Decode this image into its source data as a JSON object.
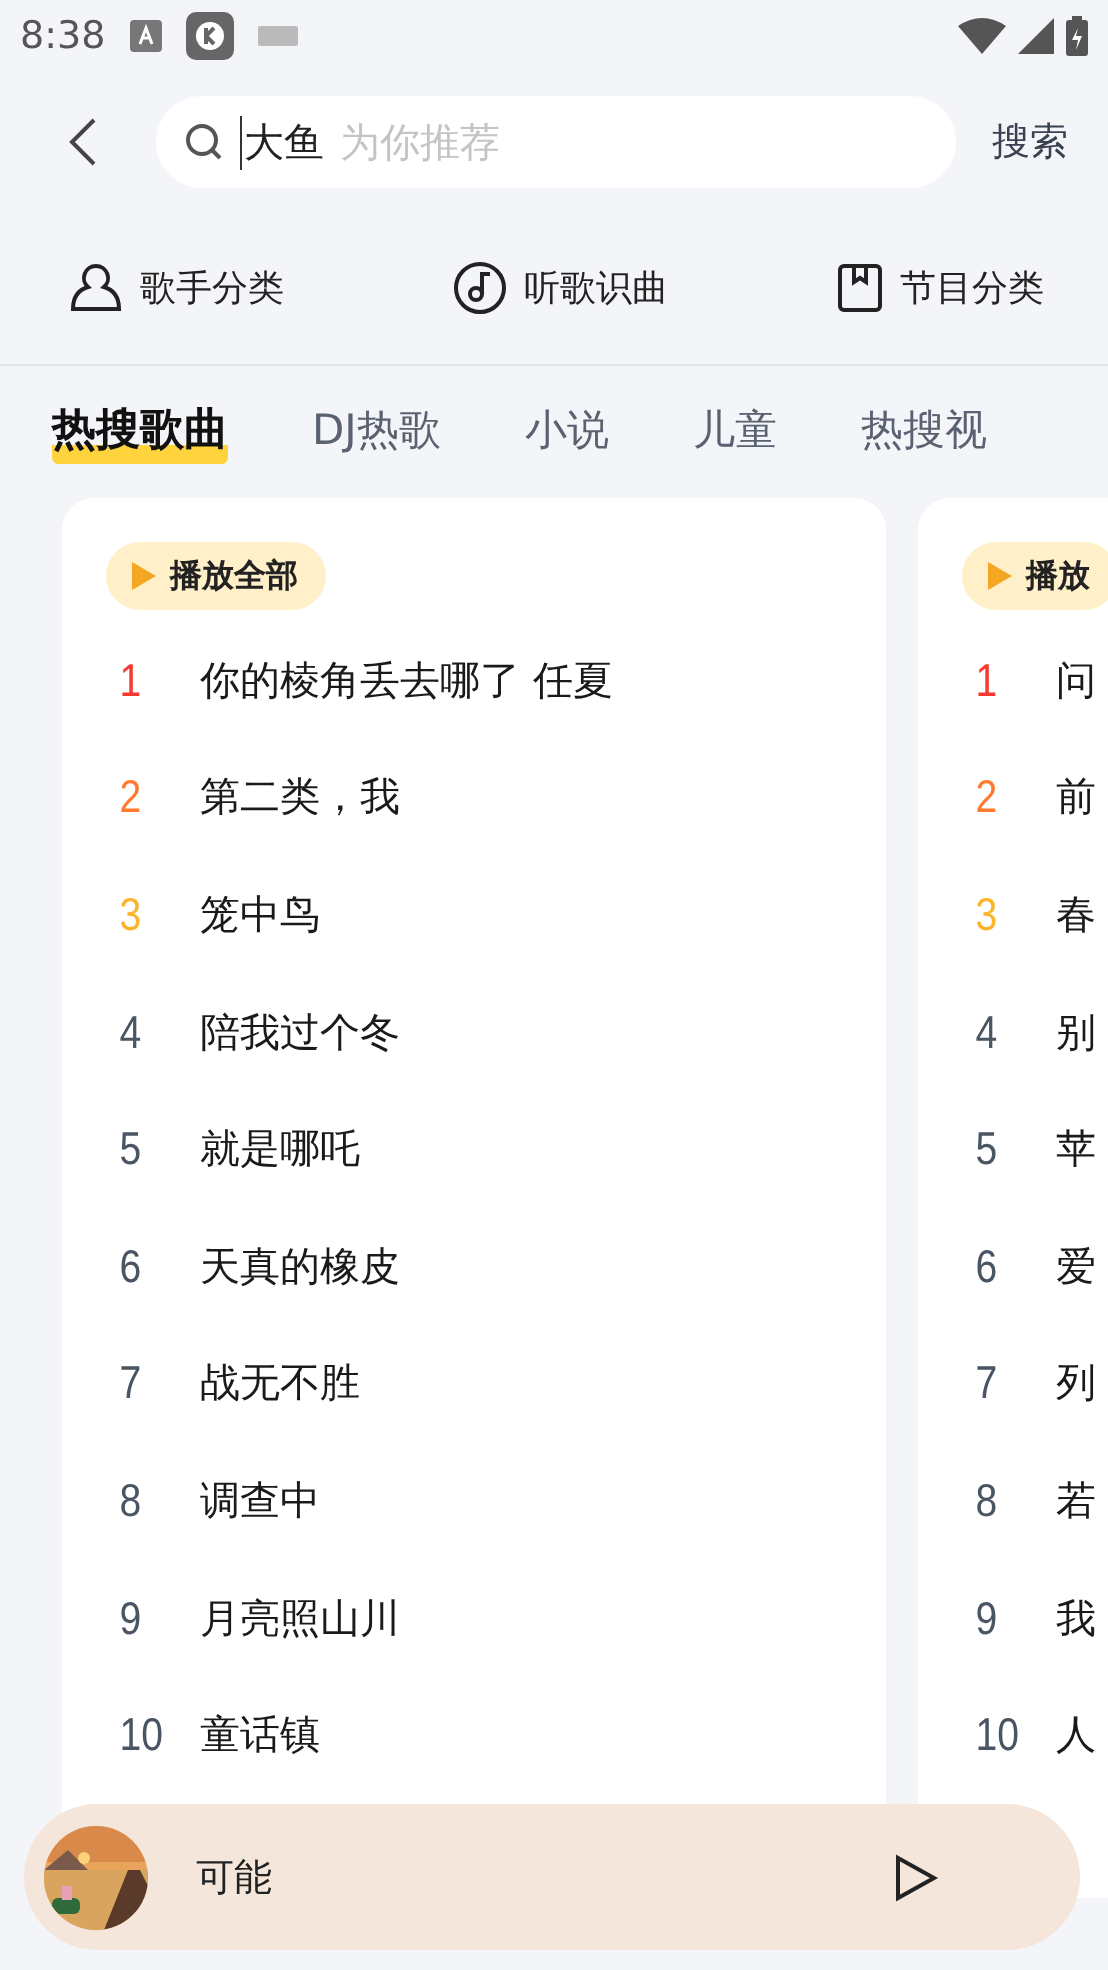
{
  "status_bar": {
    "time": "8:38"
  },
  "search": {
    "value": "大鱼",
    "placeholder": "为你推荐",
    "button": "搜索"
  },
  "shortcuts": [
    {
      "kind": "singer",
      "label": "歌手分类"
    },
    {
      "kind": "recognize",
      "label": "听歌识曲"
    },
    {
      "kind": "program",
      "label": "节目分类"
    }
  ],
  "tabs": [
    {
      "label": "热搜歌曲",
      "selected": true
    },
    {
      "label": "DJ热歌",
      "selected": false
    },
    {
      "label": "小说",
      "selected": false
    },
    {
      "label": "儿童",
      "selected": false
    },
    {
      "label": "热搜视",
      "selected": false
    }
  ],
  "charts": [
    {
      "play_all": "播放全部",
      "songs": [
        {
          "rank": "1",
          "title": "你的棱角丢去哪了  任夏",
          "color": "#f5392f"
        },
        {
          "rank": "2",
          "title": "第二类，我",
          "color": "#ff7a2e"
        },
        {
          "rank": "3",
          "title": "笼中鸟",
          "color": "#fbb52a"
        },
        {
          "rank": "4",
          "title": "陪我过个冬",
          "color": "#4a5563"
        },
        {
          "rank": "5",
          "title": "就是哪吒",
          "color": "#4a5563"
        },
        {
          "rank": "6",
          "title": "天真的橡皮",
          "color": "#4a5563"
        },
        {
          "rank": "7",
          "title": "战无不胜",
          "color": "#4a5563"
        },
        {
          "rank": "8",
          "title": "调查中",
          "color": "#4a5563"
        },
        {
          "rank": "9",
          "title": "月亮照山川",
          "color": "#4a5563"
        },
        {
          "rank": "10",
          "title": "童话镇",
          "color": "#4a5563"
        }
      ]
    },
    {
      "play_all": "播放",
      "songs": [
        {
          "rank": "1",
          "title": "问",
          "color": "#f5392f"
        },
        {
          "rank": "2",
          "title": "前",
          "color": "#ff7a2e"
        },
        {
          "rank": "3",
          "title": "春",
          "color": "#fbb52a"
        },
        {
          "rank": "4",
          "title": "别",
          "color": "#4a5563"
        },
        {
          "rank": "5",
          "title": "苹",
          "color": "#4a5563"
        },
        {
          "rank": "6",
          "title": "爱",
          "color": "#4a5563"
        },
        {
          "rank": "7",
          "title": "列",
          "color": "#4a5563"
        },
        {
          "rank": "8",
          "title": "若",
          "color": "#4a5563"
        },
        {
          "rank": "9",
          "title": "我",
          "color": "#4a5563"
        },
        {
          "rank": "10",
          "title": "人",
          "color": "#4a5563"
        }
      ]
    }
  ],
  "player": {
    "title": "可能"
  }
}
